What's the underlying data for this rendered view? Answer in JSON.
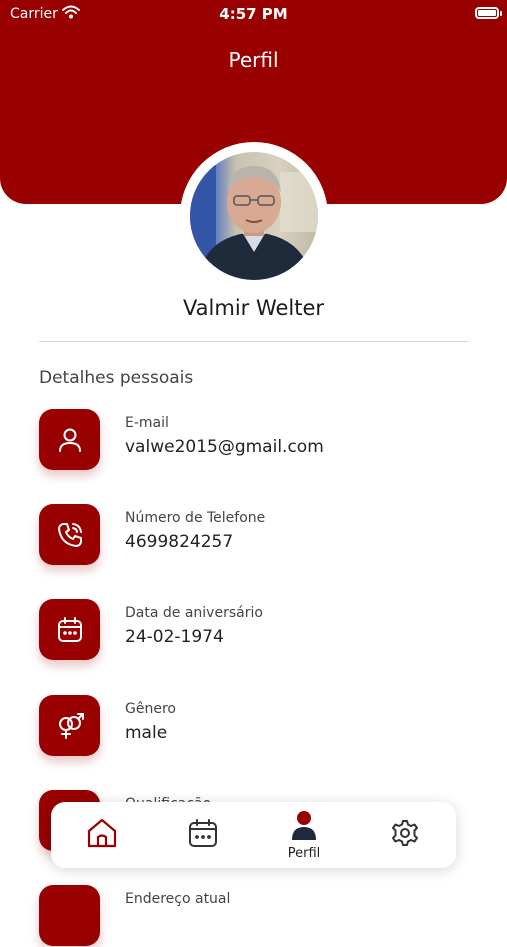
{
  "status_bar": {
    "carrier": "Carrier",
    "time": "4:57 PM"
  },
  "header": {
    "title": "Perfil"
  },
  "profile": {
    "name": "Valmir Welter"
  },
  "section": {
    "title": "Detalhes pessoais"
  },
  "details": [
    {
      "label": "E-mail",
      "value": "valwe2015@gmail.com",
      "icon": "person-icon"
    },
    {
      "label": "Número de Telefone",
      "value": "4699824257",
      "icon": "phone-icon"
    },
    {
      "label": "Data de aniversário",
      "value": "24-02-1974",
      "icon": "calendar-icon"
    },
    {
      "label": "Gênero",
      "value": "male",
      "icon": "gender-icon"
    },
    {
      "label": "Qualificação",
      "value": "",
      "icon": "qualification-icon"
    },
    {
      "label": "Endereço atual",
      "value": "",
      "icon": "address-icon"
    }
  ],
  "nav": {
    "items": [
      {
        "icon": "home-icon",
        "label": ""
      },
      {
        "icon": "calendar-icon",
        "label": ""
      },
      {
        "icon": "person-icon",
        "label": "Perfil"
      },
      {
        "icon": "gear-icon",
        "label": ""
      }
    ],
    "active_index": 2
  },
  "colors": {
    "primary": "#990000",
    "background": "#ffffff"
  }
}
